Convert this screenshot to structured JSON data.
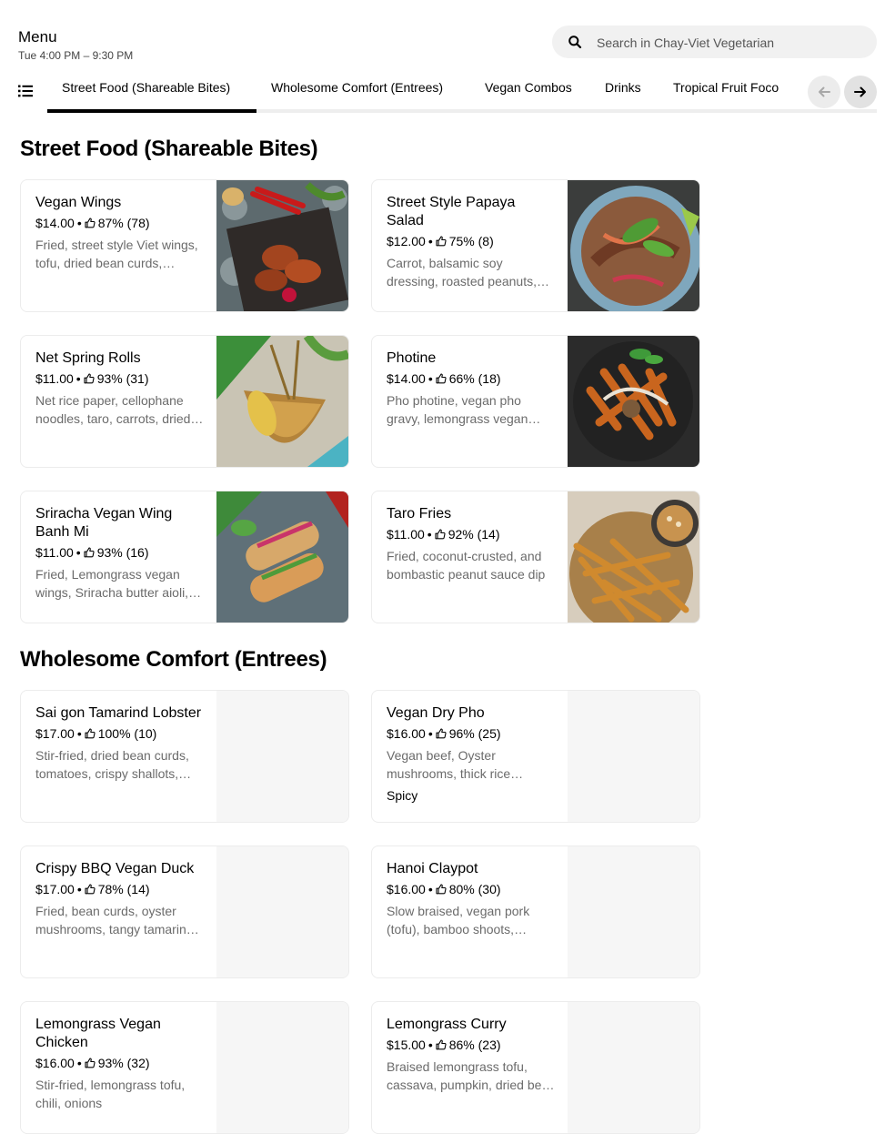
{
  "header": {
    "title": "Menu",
    "hours": "Tue 4:00 PM – 9:30 PM",
    "search_placeholder": "Search in Chay-Viet Vegetarian"
  },
  "tabs": [
    {
      "label": "Street Food (Shareable Bites)",
      "active": true
    },
    {
      "label": "Wholesome Comfort (Entrees)",
      "active": false
    },
    {
      "label": "Vegan Combos",
      "active": false
    },
    {
      "label": "Drinks",
      "active": false
    },
    {
      "label": "Tropical Fruit Foco",
      "active": false
    }
  ],
  "sections": [
    {
      "title": "Street Food (Shareable Bites)",
      "items": [
        {
          "name": "Vegan Wings",
          "price": "$14.00",
          "rating": "87% (78)",
          "description": "Fried, street style Viet wings, tofu, dried bean curds, mushrooms, sweet & spicy glaze",
          "image": "wings-photo"
        },
        {
          "name": "Street Style Papaya Salad",
          "price": "$12.00",
          "rating": "75% (8)",
          "description": "Carrot, balsamic soy dressing, roasted peanuts, fresh herbs",
          "image": "papaya-salad-photo"
        },
        {
          "name": "Net Spring Rolls",
          "price": "$11.00",
          "rating": "93% (31)",
          "description": "Net rice paper, cellophane noodles, taro, carrots, dried bean curds",
          "image": "spring-rolls-photo"
        },
        {
          "name": "Photine",
          "price": "$14.00",
          "rating": "66% (18)",
          "description": "Pho photine, vegan pho gravy, lemongrass vegan chicken, herbs",
          "image": "photine-photo"
        },
        {
          "name": "Sriracha Vegan Wing Banh Mi",
          "price": "$11.00",
          "rating": "93% (16)",
          "description": "Fried, Lemongrass vegan wings, Sriracha butter aioli, pickled veggies",
          "image": "banh-mi-photo"
        },
        {
          "name": "Taro Fries",
          "price": "$11.00",
          "rating": "92% (14)",
          "description": "Fried, coconut-crusted, and bombastic peanut sauce dip",
          "image": "taro-fries-photo"
        }
      ]
    },
    {
      "title": "Wholesome Comfort (Entrees)",
      "items": [
        {
          "name": "Sai gon Tamarind Lobster",
          "price": "$17.00",
          "rating": "100% (10)",
          "description": "Stir-fried, dried bean curds, tomatoes, crispy shallots, tamarind sauce"
        },
        {
          "name": "Vegan Dry Pho",
          "price": "$16.00",
          "rating": "96% (25)",
          "description": "Vegan beef, Oyster mushrooms, thick rice noodles, herbs",
          "tag": "Spicy"
        },
        {
          "name": "Crispy BBQ Vegan Duck",
          "price": "$17.00",
          "rating": "78% (14)",
          "description": "Fried, bean curds, oyster mushrooms, tangy tamarind glaze"
        },
        {
          "name": "Hanoi Claypot",
          "price": "$16.00",
          "rating": "80% (30)",
          "description": "Slow braised, vegan pork (tofu), bamboo shoots, caramel sauce"
        },
        {
          "name": "Lemongrass Vegan Chicken",
          "price": "$16.00",
          "rating": "93% (32)",
          "description": "Stir-fried, lemongrass tofu, chili, onions"
        },
        {
          "name": "Lemongrass Curry",
          "price": "$15.00",
          "rating": "86% (23)",
          "description": "Braised lemongrass tofu, cassava, pumpkin, dried bean curds"
        }
      ]
    }
  ],
  "colors": {
    "accent": "#000000",
    "muted_text": "#6b6b6b",
    "card_border": "#ececec",
    "search_bg": "#f1f1f1"
  }
}
